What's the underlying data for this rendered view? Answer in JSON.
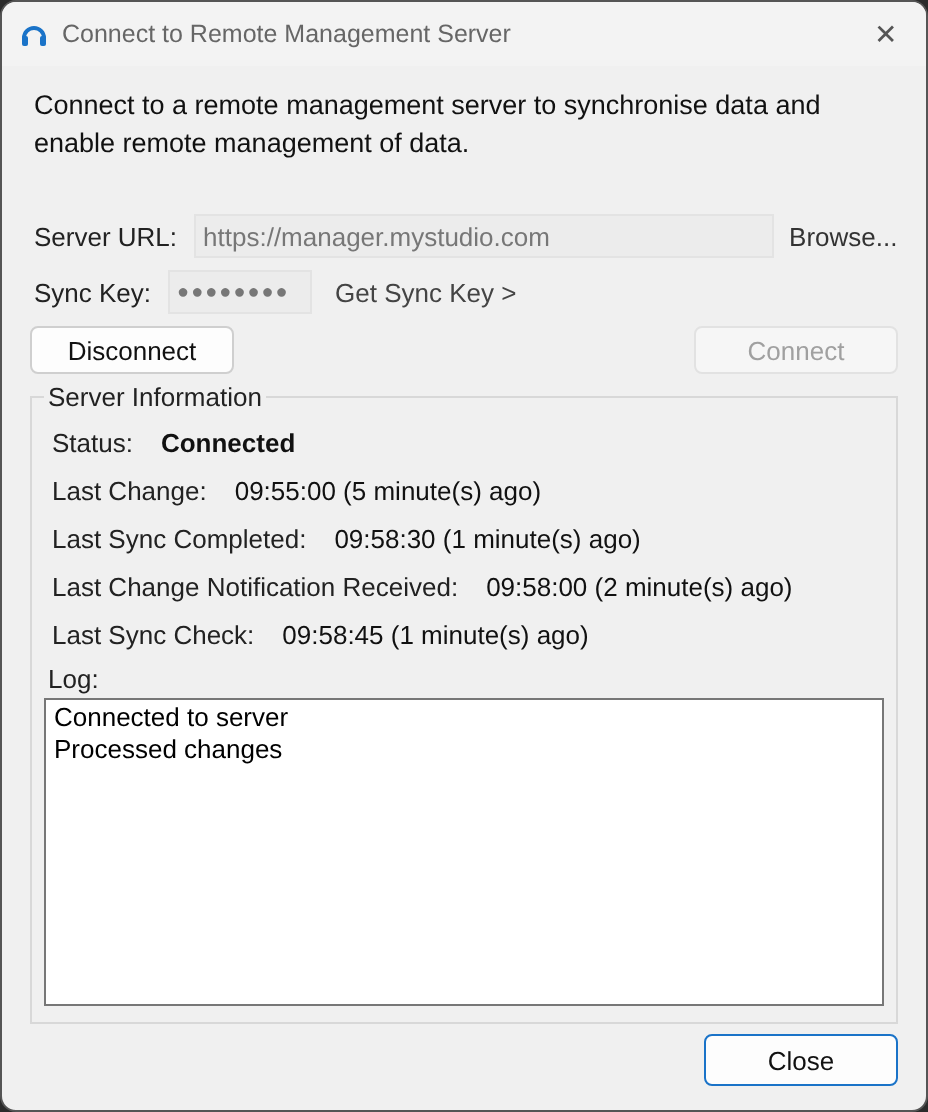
{
  "window": {
    "title": "Connect to Remote Management Server",
    "close_glyph": "✕"
  },
  "description": "Connect to a remote management server to synchronise data and enable remote management of data.",
  "server_url": {
    "label": "Server URL:",
    "value": "https://manager.mystudio.com",
    "disabled": true
  },
  "browse_button": {
    "label": "Browse...",
    "disabled": false
  },
  "sync_key": {
    "label": "Sync Key:",
    "value": "●●●●●●●●",
    "disabled": true
  },
  "get_sync_key_link": "Get Sync Key >",
  "actions": [
    {
      "label": "Disconnect",
      "disabled": false
    },
    {
      "label": "Connect",
      "disabled": true
    }
  ],
  "server_information": {
    "title": "Server Information",
    "rows": [
      {
        "label": "Status:",
        "value": "Connected",
        "kind": "status"
      },
      {
        "label": "Last Change:",
        "value": "09:55:00 (5 minute(s) ago)",
        "kind": "time"
      },
      {
        "label": "Last Sync Completed:",
        "value": "09:58:30 (1 minute(s) ago)",
        "kind": "time"
      },
      {
        "label": "Last Change Notification Received:",
        "value": "09:58:00 (2 minute(s) ago)",
        "kind": "time"
      },
      {
        "label": "Last Sync Check:",
        "value": "09:58:45 (1 minute(s) ago)",
        "kind": "time"
      }
    ],
    "log_label": "Log:",
    "log_lines": [
      "Connected to server",
      "Processed changes"
    ]
  },
  "close_button": {
    "label": "Close",
    "default": true
  }
}
